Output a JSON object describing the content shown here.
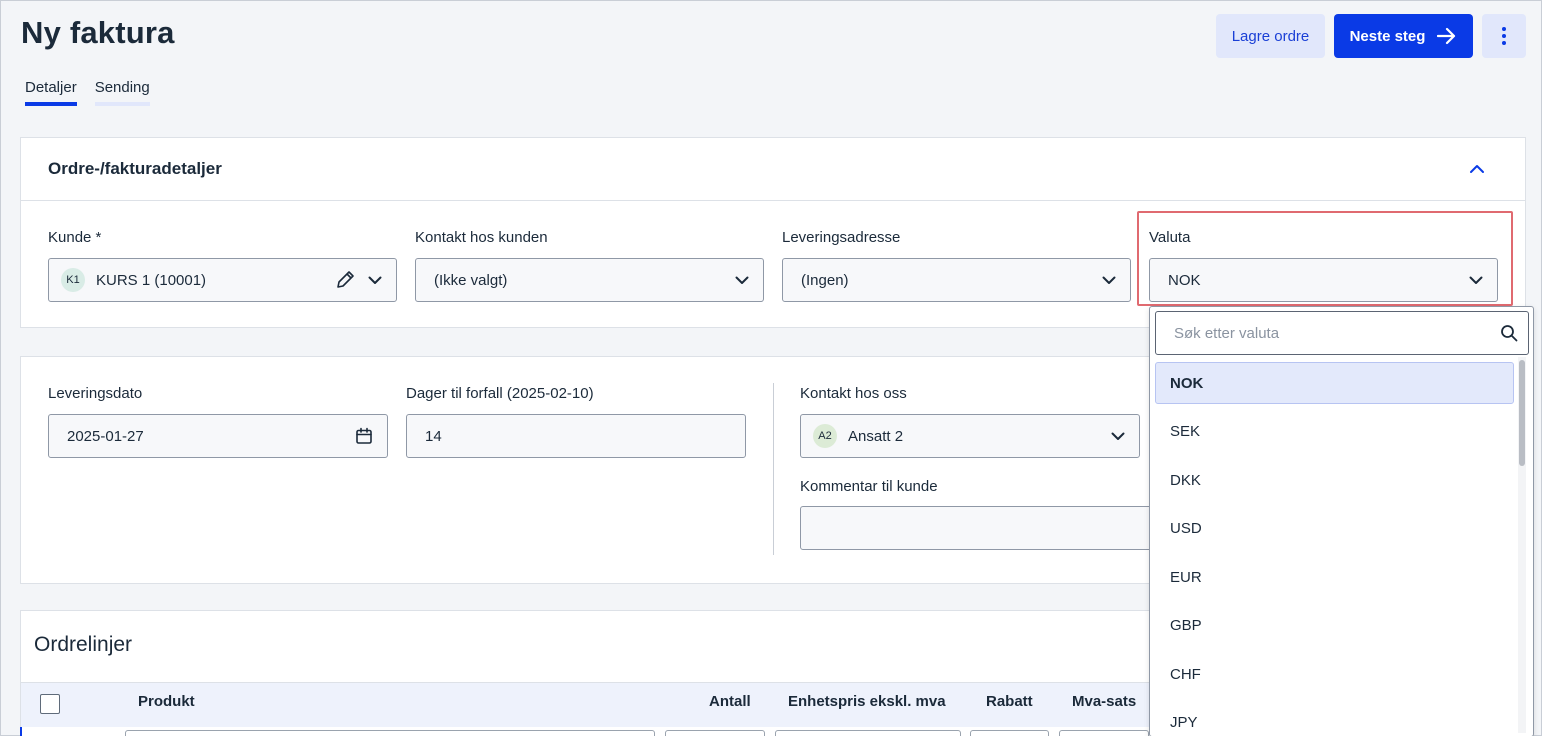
{
  "page": {
    "title": "Ny faktura"
  },
  "toolbar": {
    "save_label": "Lagre ordre",
    "next_label": "Neste steg"
  },
  "tabs": [
    {
      "label": "Detaljer",
      "active": true
    },
    {
      "label": "Sending",
      "active": false
    }
  ],
  "details": {
    "title": "Ordre-/fakturadetaljer",
    "customer": {
      "label": "Kunde *",
      "avatar": "K1",
      "value": "KURS 1 (10001)"
    },
    "customer_contact": {
      "label": "Kontakt hos kunden",
      "value": "(Ikke valgt)"
    },
    "delivery_address": {
      "label": "Leveringsadresse",
      "value": "(Ingen)"
    },
    "currency": {
      "label": "Valuta",
      "value": "NOK"
    }
  },
  "delivery": {
    "date_label": "Leveringsdato",
    "date_value": "2025-01-27",
    "due_label": "Dager til forfall (2025-02-10)",
    "due_value": "14",
    "our_contact_label": "Kontakt hos oss",
    "our_contact_avatar": "A2",
    "our_contact_value": "Ansatt 2",
    "comment_label": "Kommentar til kunde",
    "comment_value": ""
  },
  "order_lines": {
    "title": "Ordrelinjer",
    "columns": [
      "Produkt",
      "Antall",
      "Enhetspris ekskl. mva",
      "Rabatt",
      "Mva-sats"
    ]
  },
  "currency_dropdown": {
    "search_placeholder": "Søk etter valuta",
    "options": [
      "NOK",
      "SEK",
      "DKK",
      "USD",
      "EUR",
      "GBP",
      "CHF",
      "JPY"
    ],
    "selected": "NOK"
  },
  "colors": {
    "primary": "#0a3ae6",
    "secondary_bg": "#e1e7fb",
    "highlight": "#e06a70"
  },
  "icons": {
    "arrow": "arrow-right-icon",
    "more": "more-vertical-icon",
    "collapse": "chevron-up-icon",
    "dropdown": "chevron-down-icon",
    "edit": "pencil-icon",
    "calendar": "calendar-icon",
    "search": "search-icon"
  }
}
